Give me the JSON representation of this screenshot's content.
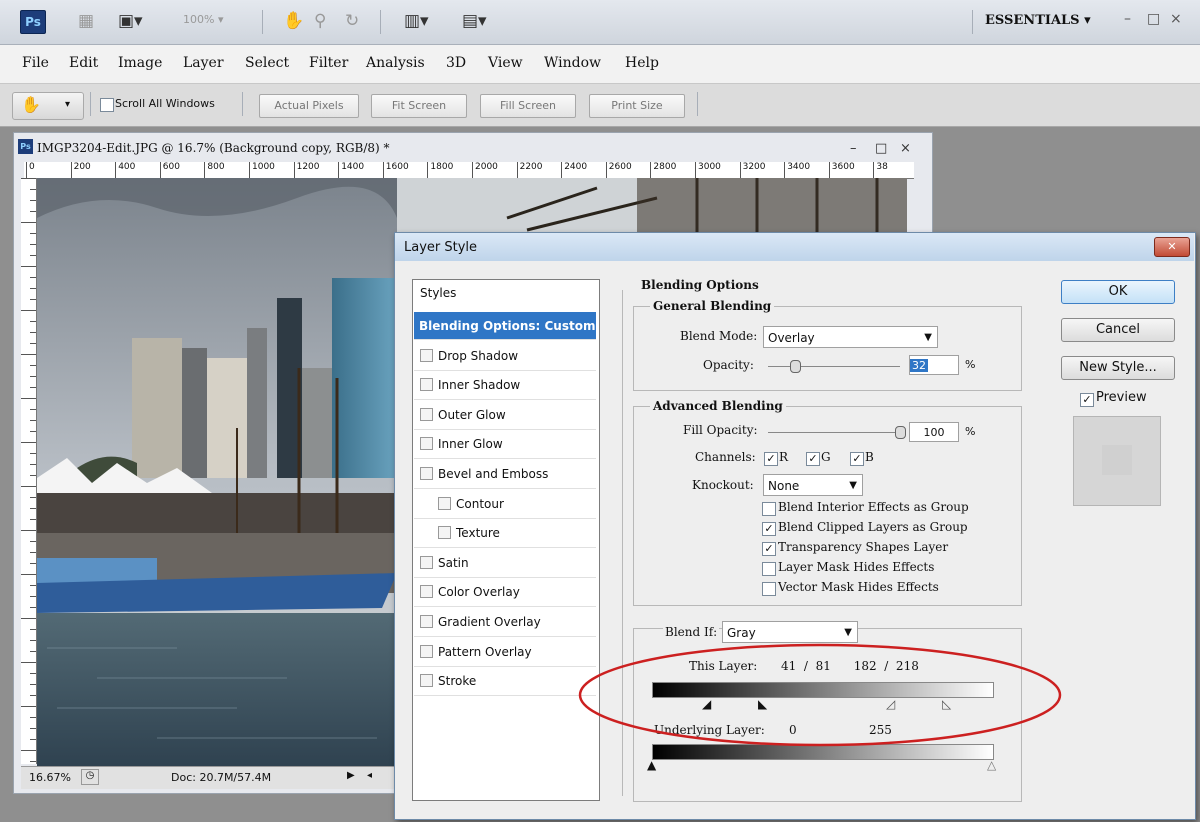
{
  "appbar": {
    "logo": "Ps",
    "zoom_value": "100%",
    "workspace": "ESSENTIALS",
    "window_controls": [
      "–",
      "□",
      "×"
    ]
  },
  "menubar": {
    "items": [
      "File",
      "Edit",
      "Image",
      "Layer",
      "Select",
      "Filter",
      "Analysis",
      "3D",
      "View",
      "Window",
      "Help"
    ]
  },
  "optionsbar": {
    "scroll_all_label": "Scroll All Windows",
    "buttons": [
      "Actual Pixels",
      "Fit Screen",
      "Fill Screen",
      "Print Size"
    ]
  },
  "document": {
    "title": "IMGP3204-Edit.JPG @ 16.7% (Background copy, RGB/8) *",
    "window_controls": [
      "–",
      "□",
      "×"
    ],
    "ruler_ticks": [
      "0",
      "200",
      "400",
      "600",
      "800",
      "1000",
      "1200",
      "1400",
      "1600",
      "1800",
      "2000",
      "2200",
      "2400",
      "2600",
      "2800",
      "3000",
      "3200",
      "3400",
      "3600",
      "38"
    ],
    "status_zoom": "16.67%",
    "status_doc": "Doc: 20.7M/57.4M"
  },
  "dialog": {
    "title": "Layer Style",
    "close_label": "✕",
    "styles_header": "Styles",
    "styles": [
      {
        "label": "Blending Options: Custom",
        "selected": true,
        "checkbox": false,
        "indent": false
      },
      {
        "label": "Drop Shadow",
        "checkbox": true,
        "indent": false
      },
      {
        "label": "Inner Shadow",
        "checkbox": true,
        "indent": false
      },
      {
        "label": "Outer Glow",
        "checkbox": true,
        "indent": false
      },
      {
        "label": "Inner Glow",
        "checkbox": true,
        "indent": false
      },
      {
        "label": "Bevel and Emboss",
        "checkbox": true,
        "indent": false
      },
      {
        "label": "Contour",
        "checkbox": true,
        "indent": true
      },
      {
        "label": "Texture",
        "checkbox": true,
        "indent": true
      },
      {
        "label": "Satin",
        "checkbox": true,
        "indent": false
      },
      {
        "label": "Color Overlay",
        "checkbox": true,
        "indent": false
      },
      {
        "label": "Gradient Overlay",
        "checkbox": true,
        "indent": false
      },
      {
        "label": "Pattern Overlay",
        "checkbox": true,
        "indent": false
      },
      {
        "label": "Stroke",
        "checkbox": true,
        "indent": false
      }
    ],
    "blending": {
      "section_title": "Blending Options",
      "general_title": "General Blending",
      "blend_mode_label": "Blend Mode:",
      "blend_mode_value": "Overlay",
      "opacity_label": "Opacity:",
      "opacity_value": "32",
      "opacity_unit": "%",
      "advanced_title": "Advanced Blending",
      "fill_opacity_label": "Fill Opacity:",
      "fill_opacity_value": "100",
      "fill_opacity_unit": "%",
      "channels_label": "Channels:",
      "channels": [
        "R",
        "G",
        "B"
      ],
      "knockout_label": "Knockout:",
      "knockout_value": "None",
      "options": [
        {
          "label": "Blend Interior Effects as Group",
          "checked": false
        },
        {
          "label": "Blend Clipped Layers as Group",
          "checked": true
        },
        {
          "label": "Transparency Shapes Layer",
          "checked": true
        },
        {
          "label": "Layer Mask Hides Effects",
          "checked": false
        },
        {
          "label": "Vector Mask Hides Effects",
          "checked": false
        }
      ],
      "blend_if_label": "Blend If:",
      "blend_if_value": "Gray",
      "this_layer_label": "This Layer:",
      "this_layer_values": "41  /  81      182  /  218",
      "underlying_label": "Underlying Layer:",
      "underlying_low": "0",
      "underlying_high": "255"
    },
    "buttons": {
      "ok": "OK",
      "cancel": "Cancel",
      "new_style": "New Style...",
      "preview_label": "Preview"
    }
  },
  "annotation": {
    "color": "#cc2020"
  }
}
